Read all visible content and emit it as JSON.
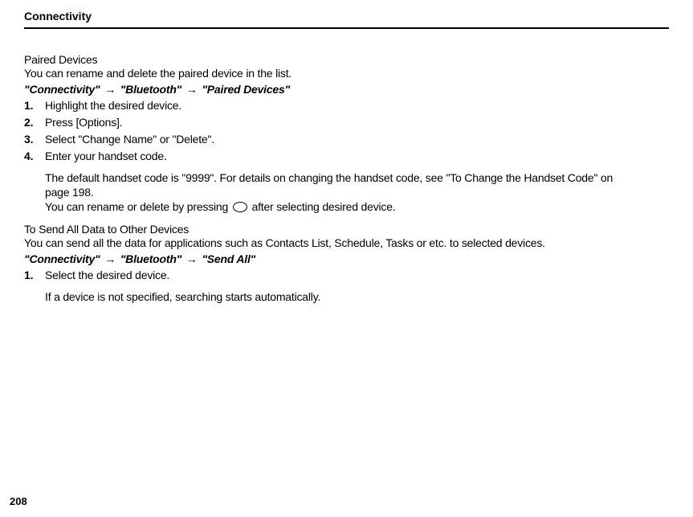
{
  "header": {
    "title": "Connectivity"
  },
  "section1": {
    "title": "Paired Devices",
    "desc": "You can rename and delete the paired device in the list.",
    "breadcrumb": {
      "part1": "\"Connectivity\"",
      "part2": "\"Bluetooth\"",
      "part3": "\"Paired Devices\""
    },
    "steps": [
      {
        "num": "1.",
        "text": "Highlight the desired device."
      },
      {
        "num": "2.",
        "text": "Press [Options]."
      },
      {
        "num": "3.",
        "text": "Select \"Change Name\" or \"Delete\"."
      },
      {
        "num": "4.",
        "text": "Enter your handset code."
      }
    ],
    "note_line1": "The default handset code is \"9999\". For details on changing the handset code, see \"To Change the Handset Code\" on page 198.",
    "note_line2a": "You can rename or delete by pressing ",
    "note_line2b": " after selecting desired device."
  },
  "section2": {
    "title": "To Send All Data to Other Devices",
    "desc": "You can send all the data for applications such as Contacts List, Schedule, Tasks or etc. to selected devices.",
    "breadcrumb": {
      "part1": "\"Connectivity\"",
      "part2": "\"Bluetooth\"",
      "part3": "\"Send All\""
    },
    "steps": [
      {
        "num": "1.",
        "text": "Select the desired device."
      }
    ],
    "note": "If a device is not specified, searching starts automatically."
  },
  "pageNumber": "208"
}
